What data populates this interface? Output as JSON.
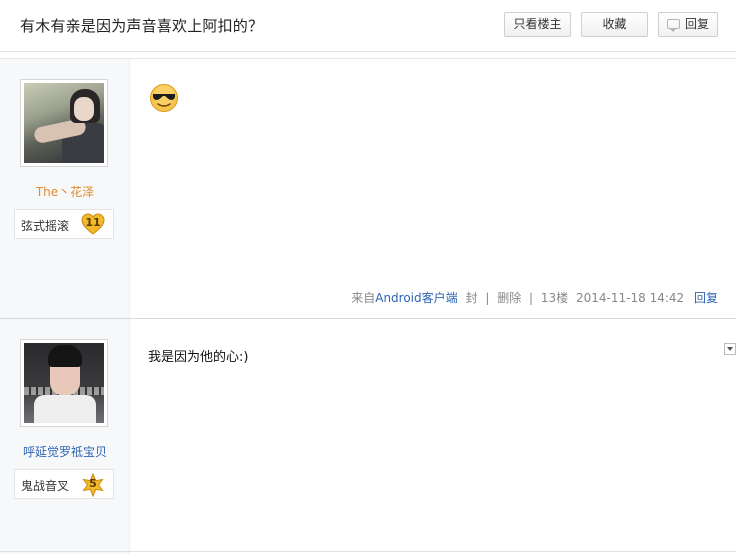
{
  "thread": {
    "title": "有木有亲是因为声音喜欢上阿扣的？",
    "buttons": {
      "only_op": "只看楼主",
      "favorite": "收藏",
      "reply": "回复"
    }
  },
  "posts": [
    {
      "author": {
        "name": "The丶花泽",
        "badge_name": "弦式摇滚",
        "level": "11"
      },
      "content": {
        "emoji": "cool-sunglasses-emoji"
      },
      "meta": {
        "source_prefix": "来自",
        "source_link": "Android客户端",
        "block": "封",
        "delete": "删除",
        "floor": "13楼",
        "time": "2014-11-18 14:42",
        "reply": "回复"
      }
    },
    {
      "author": {
        "name": "呼延觉罗祗宝贝",
        "badge_name": "鬼战音叉",
        "level": "5"
      },
      "content": {
        "text": "我是因为他的心:)"
      }
    }
  ],
  "colors": {
    "accent_link": "#2d64b3",
    "author_orange": "#e08a2e",
    "badge_gold": "#f2b928"
  }
}
